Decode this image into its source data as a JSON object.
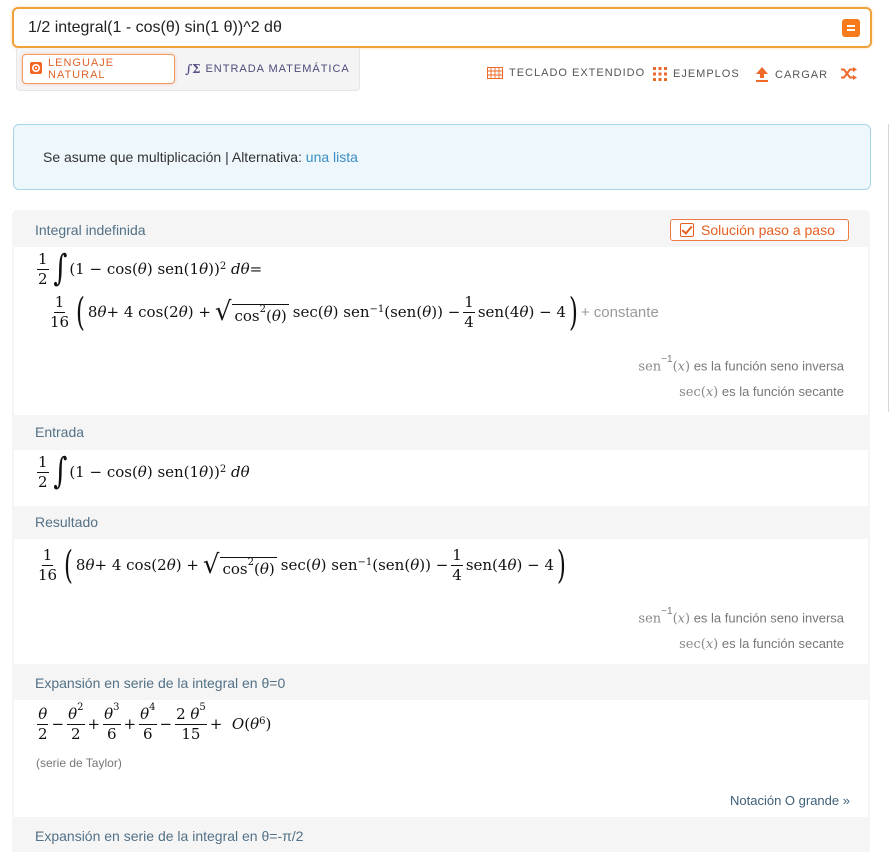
{
  "search": {
    "query": "1/2 integral(1 - cos(θ) sin(1 θ))^2 dθ"
  },
  "modes": {
    "natural": "LENGUAJE NATURAL",
    "math": "ENTRADA MATEMÁTICA",
    "math_icon": "∫Σ"
  },
  "tools": {
    "keyboard": "TECLADO EXTENDIDO",
    "examples": "EJEMPLOS",
    "upload": "CARGAR"
  },
  "assumption": {
    "text": "Se asume que multiplicación | Alternativa: ",
    "link": "una lista"
  },
  "pods": {
    "integral": {
      "title": "Integral indefinida",
      "step_button": "Solución paso a paso",
      "constant": "+ constante"
    },
    "input": {
      "title": "Entrada"
    },
    "result": {
      "title": "Resultado"
    },
    "series0": {
      "title": "Expansión en serie de la integral en θ=0",
      "note": "(serie de Taylor)",
      "link": "Notación O grande »"
    },
    "series1": {
      "title": "Expansión en serie de la integral en θ=-π/2"
    }
  },
  "notes": {
    "arcsin_fn": "sen",
    "arcsin_text": "es la función seno inversa",
    "sec_fn": "sec",
    "sec_text": "es la función secante"
  },
  "colors": {
    "accent": "#f77b1d",
    "link": "#3a8fc4",
    "pod_title": "#537187"
  },
  "icons": [
    "equals-icon",
    "gear-icon",
    "math-input-icon",
    "keyboard-icon",
    "examples-grid-icon",
    "upload-icon",
    "shuffle-icon",
    "checkbox-icon"
  ]
}
